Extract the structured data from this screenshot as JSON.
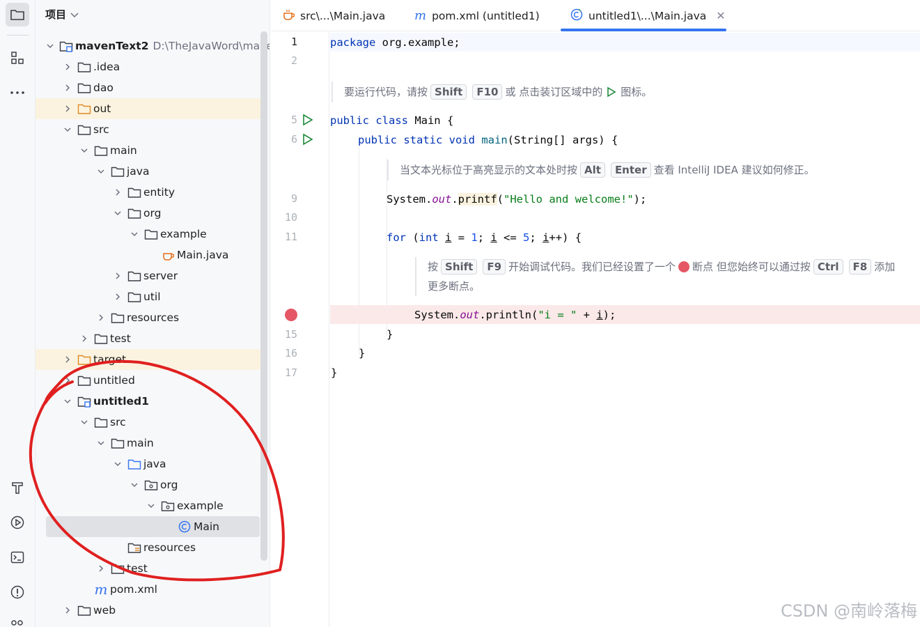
{
  "toolbar": {
    "project_icon": "folder-icon",
    "structure_icon": "structure-icon",
    "more_icon": "more-icon",
    "build_icon": "hammer-icon",
    "run_icon": "run-icon",
    "terminal_icon": "terminal-icon",
    "problems_icon": "problems-icon"
  },
  "project": {
    "title": "项目",
    "root_label": "mavenText2",
    "root_path": "D:\\TheJavaWord\\maven",
    "items": [
      {
        "label": ".idea"
      },
      {
        "label": "dao"
      },
      {
        "label": "out"
      },
      {
        "label": "src"
      },
      {
        "label": "main"
      },
      {
        "label": "java"
      },
      {
        "label": "entity"
      },
      {
        "label": "org"
      },
      {
        "label": "example"
      },
      {
        "label": "Main.java"
      },
      {
        "label": "server"
      },
      {
        "label": "util"
      },
      {
        "label": "resources"
      },
      {
        "label": "test"
      },
      {
        "label": "target"
      },
      {
        "label": "untitled"
      },
      {
        "label": "untitled1"
      },
      {
        "label": "src"
      },
      {
        "label": "main"
      },
      {
        "label": "java"
      },
      {
        "label": "org"
      },
      {
        "label": "example"
      },
      {
        "label": "Main"
      },
      {
        "label": "resources"
      },
      {
        "label": "test"
      },
      {
        "label": "pom.xml"
      },
      {
        "label": "web"
      }
    ]
  },
  "tabs": [
    {
      "label": "src\\...\\Main.java"
    },
    {
      "label": "pom.xml (untitled1)"
    },
    {
      "label": "untitled1\\...\\Main.java"
    }
  ],
  "editor": {
    "line_numbers": [
      "1",
      "2",
      "5",
      "6",
      "9",
      "10",
      "11",
      "15",
      "16",
      "17"
    ],
    "code": {
      "l1_kw": "package",
      "l1_rest": " org.example;",
      "l5_kw": "public class",
      "l5_rest": " Main {",
      "l6_kw": "public static void",
      "l6_fn": "main",
      "l6_rest": "(String[] args) {",
      "l9_a": "System.",
      "l9_out": "out",
      "l9_dot": ".",
      "l9_fn": "printf",
      "l9_open": "(",
      "l9_str": "\"Hello and welcome!\"",
      "l9_close": ");",
      "l11_kw": "for",
      "l11_a": " (",
      "l11_int": "int",
      "l11_i1": "i",
      "l11_eq": " = ",
      "l11_n1": "1",
      "l11_semi": "; ",
      "l11_i2": "i",
      "l11_le": " <= ",
      "l11_n5": "5",
      "l11_semi2": "; ",
      "l11_i3": "i",
      "l11_end": "++) {",
      "l14_a": "System.",
      "l14_out": "out",
      "l14_b": ".println(",
      "l14_str": "\"i = \"",
      "l14_plus": " + ",
      "l14_i": "i",
      "l14_end": ");",
      "l15": "}",
      "l16": "}",
      "l17": "}"
    },
    "hint1": {
      "a": "要运行代码，请按",
      "k1": "Shift",
      "k2": "F10",
      "b": "或 点击装订区域中的",
      "c": "图标。"
    },
    "hint2": {
      "a": "当文本光标位于高亮显示的文本处时按",
      "k1": "Alt",
      "k2": "Enter",
      "b": "查看 IntelliJ IDEA 建议如何修正。"
    },
    "hint3": {
      "a": "按",
      "k1": "Shift",
      "k2": "F9",
      "b": "开始调试代码。我们已经设置了一个",
      "c": "断点 但您始终可以通过按",
      "k3": "Ctrl",
      "k4": "F8",
      "d": "添加",
      "e": "更多断点。"
    }
  },
  "watermark": "CSDN @南岭落梅",
  "colors": {
    "accent": "#3574f0",
    "breakpoint": "#e55765",
    "annotation": "#e02020"
  }
}
